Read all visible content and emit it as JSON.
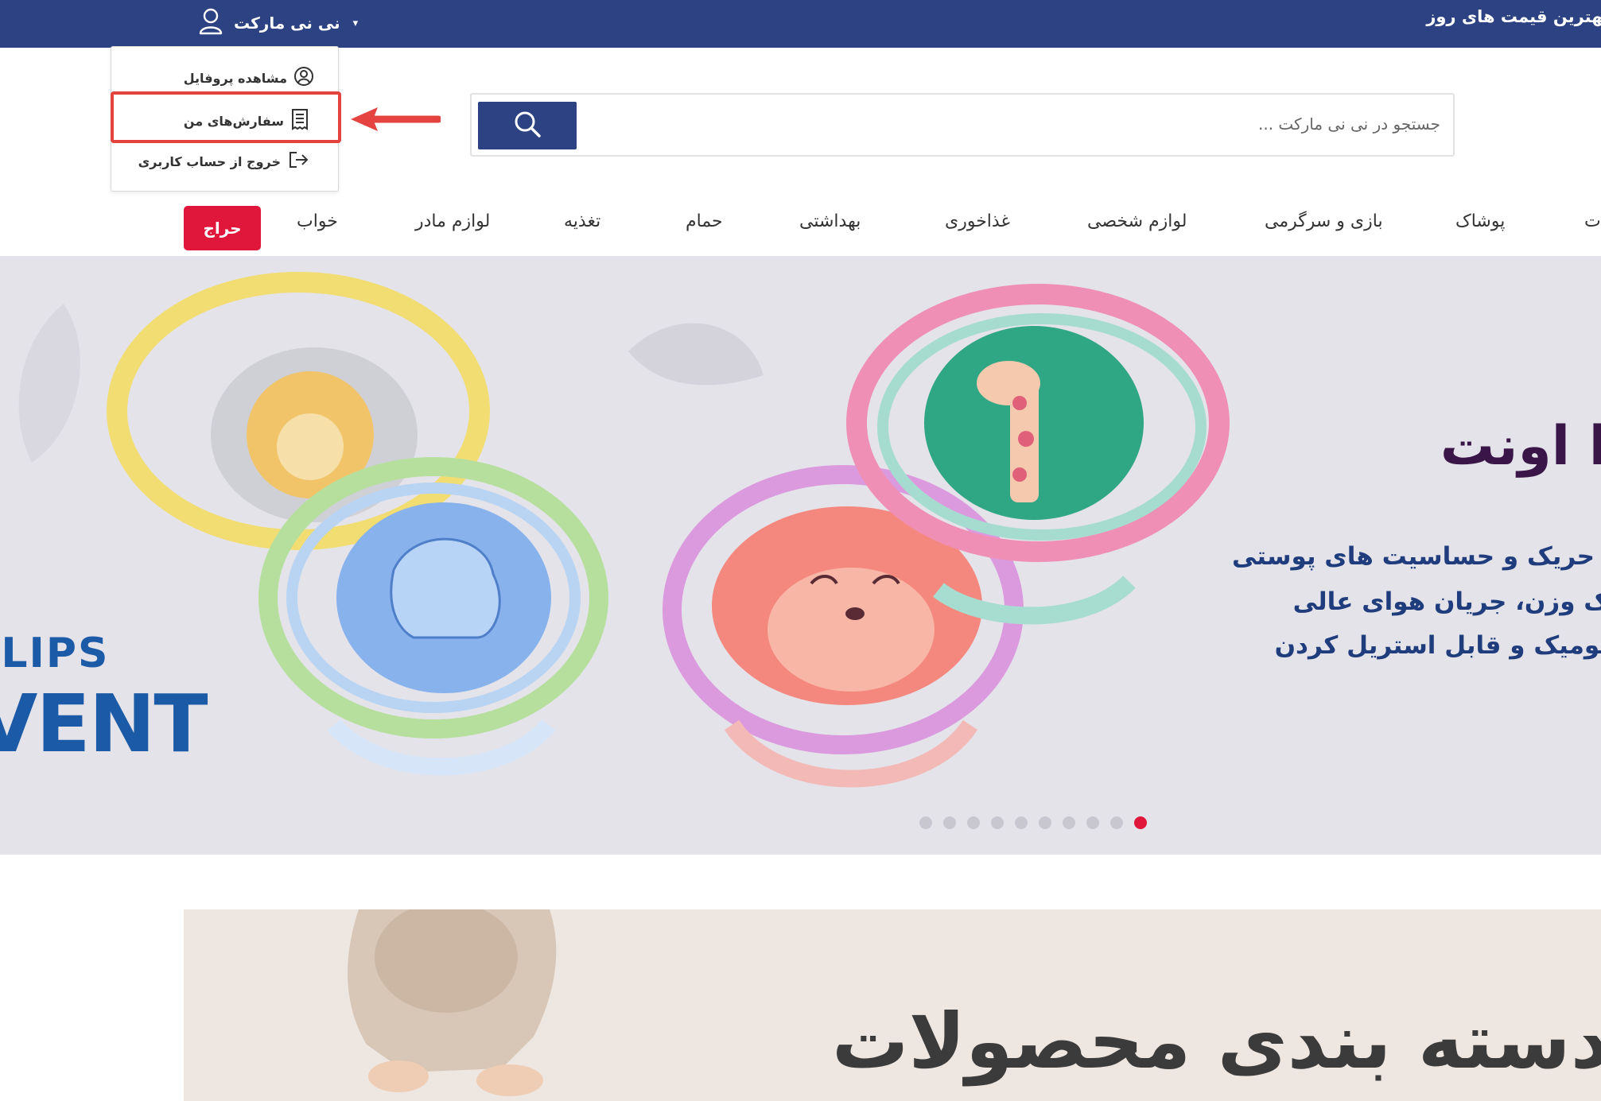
{
  "topbar": {
    "promo_text": "بهترین قیمت های روز",
    "username": "نی نی مارکت",
    "caret": "▾"
  },
  "user_menu": {
    "items": [
      {
        "label": "مشاهده پروفایل",
        "icon": "user-circle-icon"
      },
      {
        "label": "سفارش‌های من",
        "icon": "receipt-icon"
      },
      {
        "label": "خروج از حساب کاربری",
        "icon": "logout-icon"
      }
    ]
  },
  "search": {
    "placeholder": "جستجو در نی نی مارکت ..."
  },
  "nav": {
    "items": [
      "ت",
      "پوشاک",
      "بازی و سرگرمی",
      "لوازم شخصی",
      "غذاخوری",
      "بهداشتی",
      "حمام",
      "تغذیه",
      "لوازم مادر",
      "خواب"
    ],
    "sale_label": "حراج"
  },
  "hero": {
    "title": "ا اونت",
    "lines": [
      "حریک و حساسیت های پوستی",
      "ک وزن، جریان هوای عالی",
      "تومیک و قابل استریل کردن"
    ],
    "brand_top": "ILIPS",
    "brand_bottom": "VENT",
    "slide_count": 10,
    "active_slide": 10
  },
  "category_banner": {
    "title": "دسته بندی محصولات"
  },
  "colors": {
    "brand_blue": "#2c4282",
    "sale_red": "#e0173a",
    "highlight_red": "#e4433f"
  }
}
